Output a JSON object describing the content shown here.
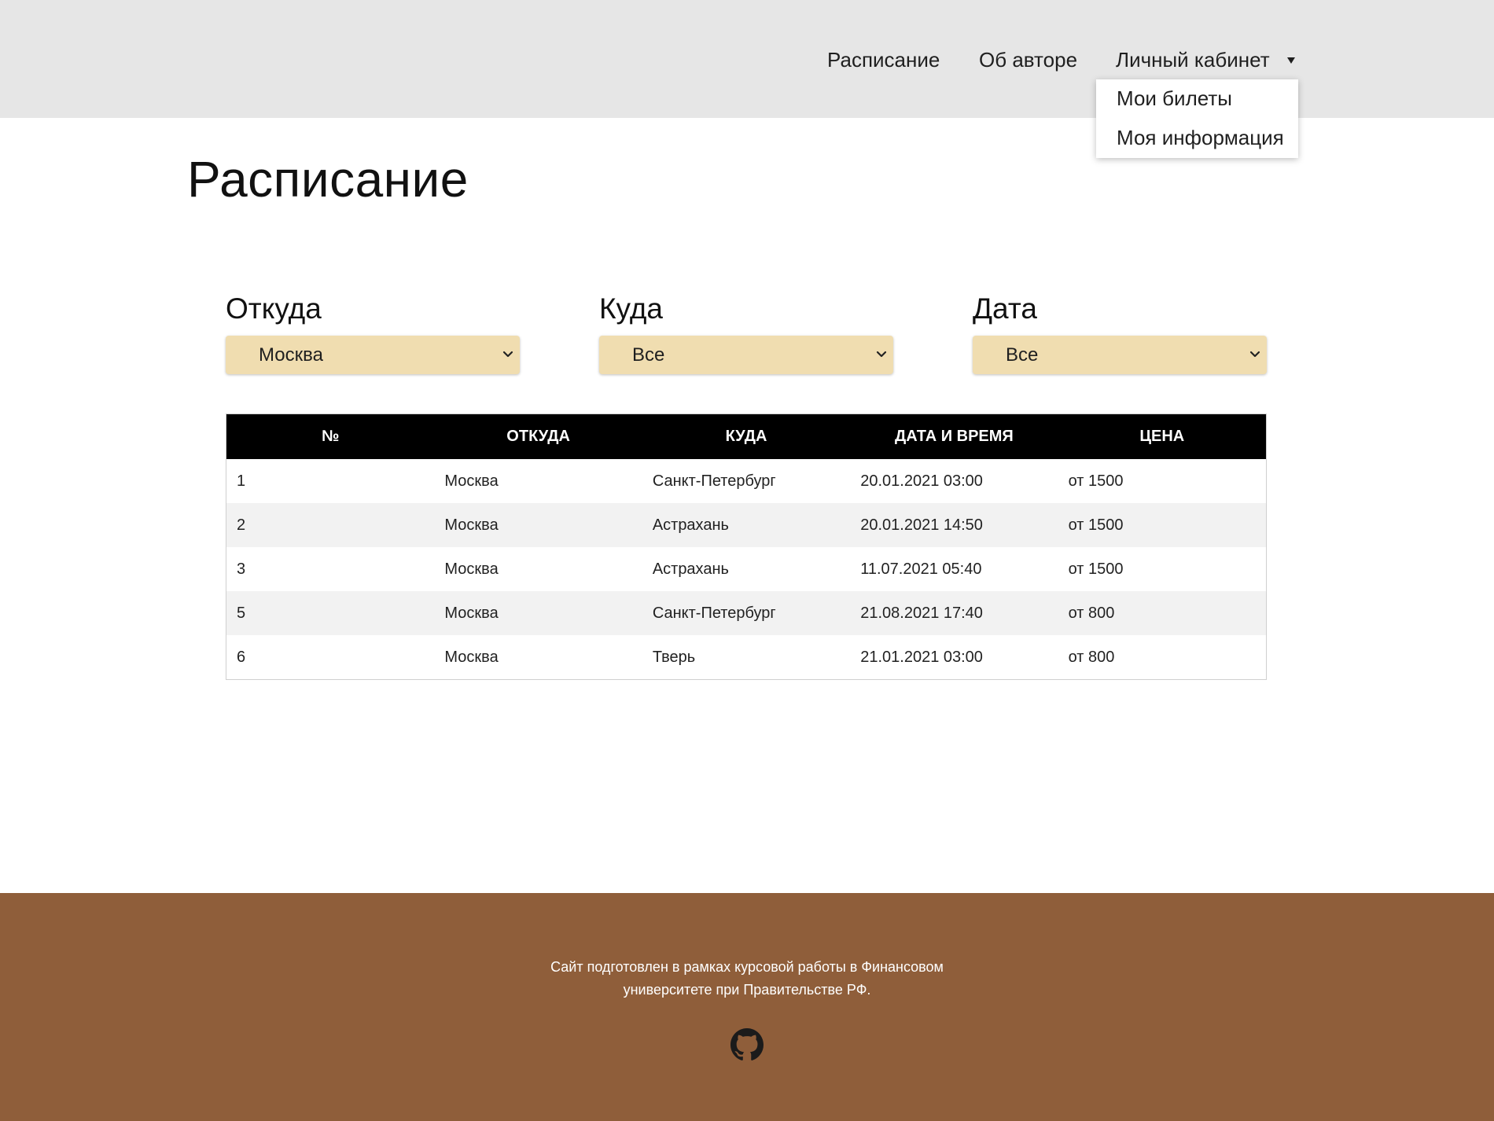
{
  "nav": {
    "schedule": "Расписание",
    "about": "Об авторе",
    "account": "Личный кабинет",
    "dropdown": [
      "Мои билеты",
      "Моя информация"
    ]
  },
  "page": {
    "title": "Расписание"
  },
  "filters": {
    "from": {
      "label": "Откуда",
      "value": "Москва"
    },
    "to": {
      "label": "Куда",
      "value": "Все"
    },
    "date": {
      "label": "Дата",
      "value": "Все"
    }
  },
  "table": {
    "headers": [
      "№",
      "ОТКУДА",
      "КУДА",
      "ДАТА И ВРЕМЯ",
      "ЦЕНА"
    ],
    "rows": [
      [
        "1",
        "Москва",
        "Санкт-Петербург",
        "20.01.2021 03:00",
        "от 1500"
      ],
      [
        "2",
        "Москва",
        "Астрахань",
        "20.01.2021 14:50",
        "от 1500"
      ],
      [
        "3",
        "Москва",
        "Астрахань",
        "11.07.2021 05:40",
        "от 1500"
      ],
      [
        "5",
        "Москва",
        "Санкт-Петербург",
        "21.08.2021 17:40",
        "от 800"
      ],
      [
        "6",
        "Москва",
        "Тверь",
        "21.01.2021 03:00",
        "от 800"
      ]
    ]
  },
  "footer": {
    "line1": "Сайт подготовлен в рамках курсовой работы в Финансовом",
    "line2": "университете при Правительстве РФ.",
    "icon": "github-icon"
  },
  "colors": {
    "header_bg": "#e6e6e6",
    "select_bg": "#f0ddb0",
    "table_head_bg": "#000000",
    "footer_bg": "#8f5e3a"
  }
}
